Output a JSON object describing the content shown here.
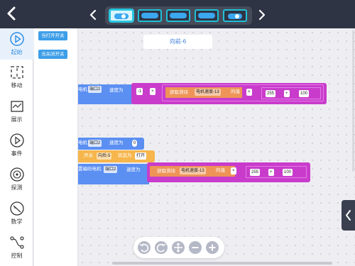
{
  "sidebar": {
    "items": [
      {
        "label": "起始",
        "icon": "play-icon"
      },
      {
        "label": "移动",
        "icon": "move-icon"
      },
      {
        "label": "展示",
        "icon": "display-icon"
      },
      {
        "label": "事件",
        "icon": "event-icon"
      },
      {
        "label": "探测",
        "icon": "radar-icon"
      },
      {
        "label": "数学",
        "icon": "math-icon"
      },
      {
        "label": "控制",
        "icon": "control-icon"
      }
    ],
    "active_color": "#2d8ce6"
  },
  "palette": {
    "blocks": [
      "当打开开关",
      "当关闭开关"
    ]
  },
  "canvas": {
    "title": "向前-6",
    "block1": {
      "text_a": "电机",
      "port": "端口2",
      "text_b": "速度为",
      "neg": "-1",
      "op1": "×",
      "sensor_label": "获取滑块",
      "sensor_name": "电机速度-13",
      "sensor_suffix": "的值",
      "op2": "×",
      "num1": "255",
      "op3": "+",
      "num2": "100"
    },
    "block2": {
      "text_a": "电机",
      "port": "端口2",
      "text_b": "速度为",
      "value": "0"
    },
    "block3": {
      "text_a": "开关",
      "switch_name": "向后-5",
      "text_b": "状态为",
      "state": "打开"
    },
    "block4": {
      "text_a": "置编码电机",
      "port": "端口2",
      "text_b": "速度为",
      "sensor_label": "获取滑块",
      "sensor_name": "电机速度-13",
      "sensor_suffix": "的值",
      "op1": "×",
      "num1": "255",
      "op2": "+",
      "num2": "100"
    }
  },
  "colors": {
    "topbar": "#2f3444",
    "motion_block": "#5b8ff2",
    "math_block": "#c93ccb",
    "sensor_block": "#ee9458",
    "event_block": "#f6b64c"
  }
}
